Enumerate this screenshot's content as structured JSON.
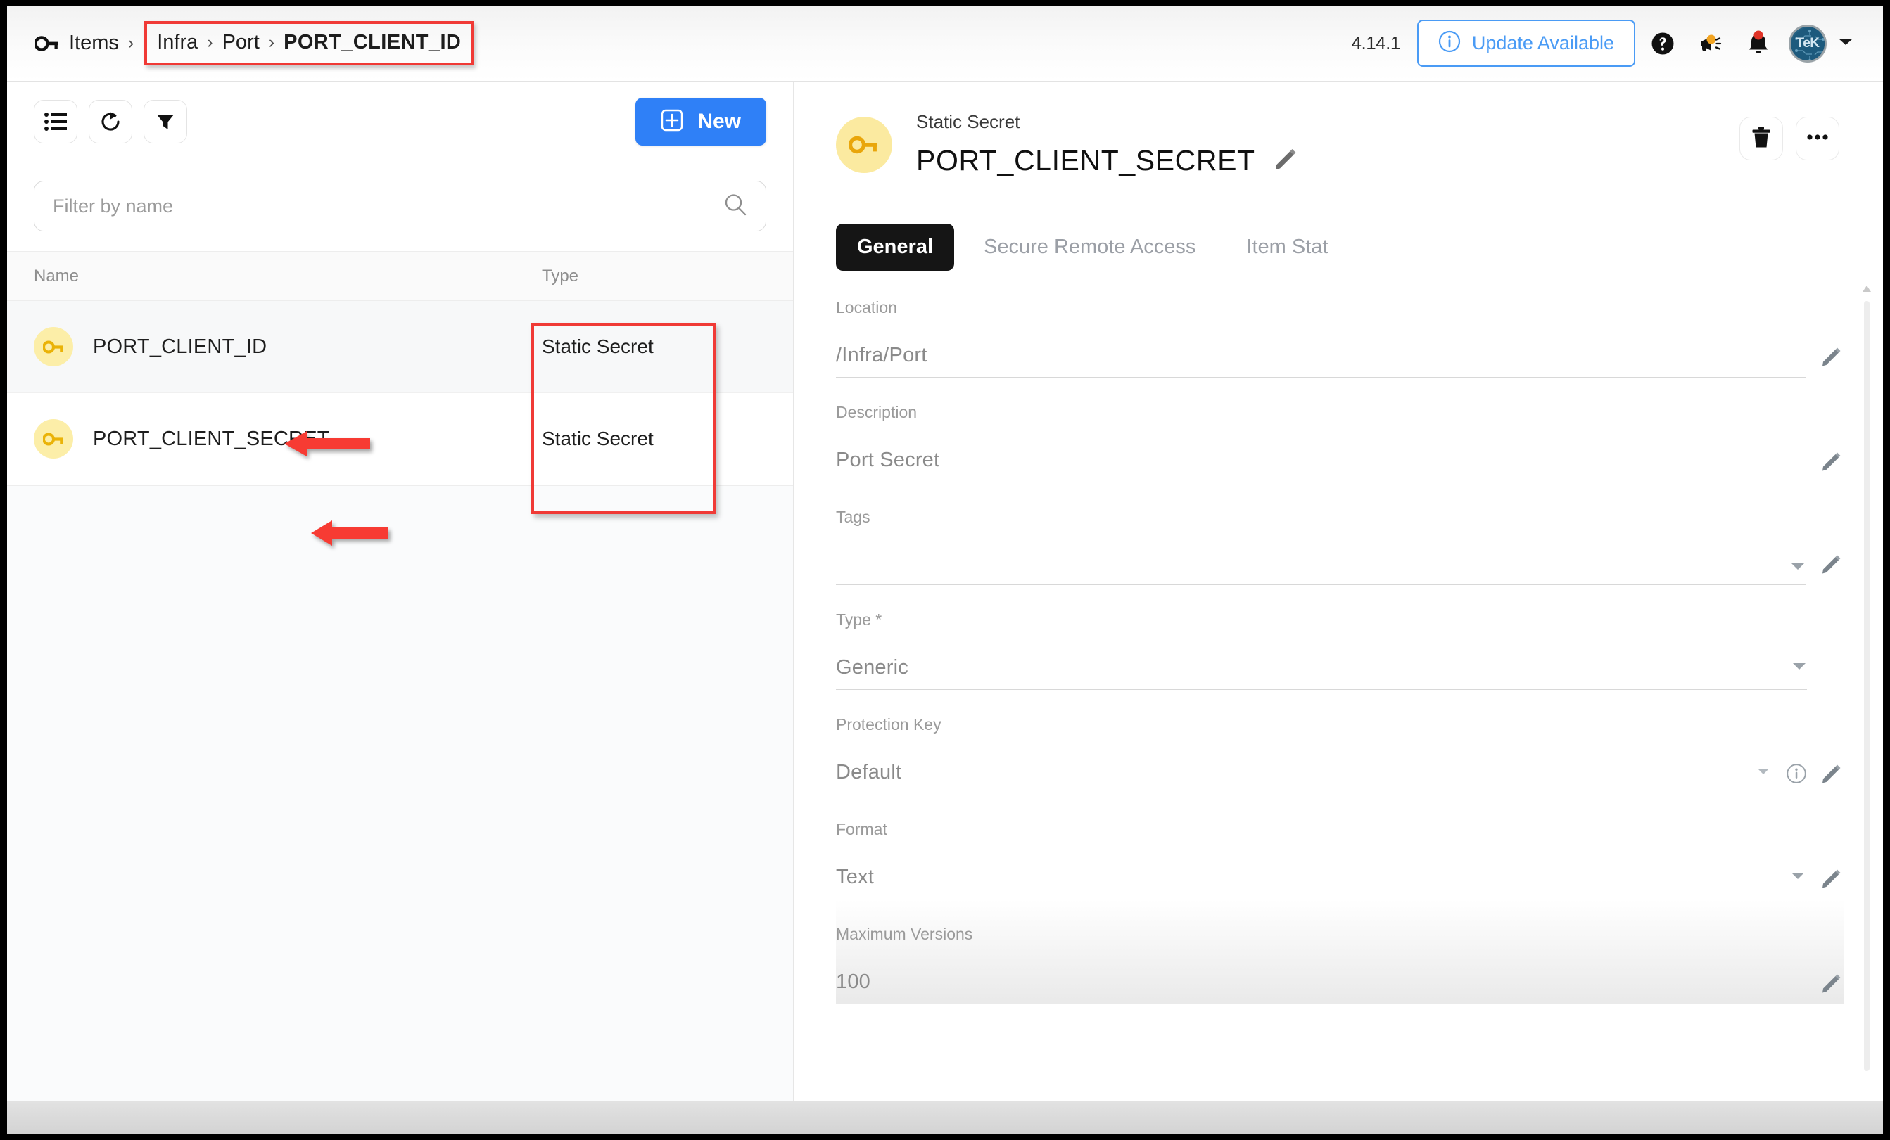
{
  "topbar": {
    "root_crumb": "Items",
    "separator": "›",
    "breadcrumb_highlighted": [
      {
        "label": "Infra",
        "bold": false
      },
      {
        "label": "Port",
        "bold": false
      },
      {
        "label": "PORT_CLIENT_ID",
        "bold": true
      }
    ],
    "version": "4.14.1",
    "update_label": "Update Available",
    "avatar_initials": "TeK",
    "icons": {
      "key": "key-icon",
      "info": "info-circle-icon",
      "help": "help-circle-icon",
      "announcement": "megaphone-icon",
      "notification": "bell-icon",
      "caret": "chevron-down-icon"
    }
  },
  "left_panel": {
    "toolbar": {
      "list_view": "list-view-icon",
      "refresh": "refresh-icon",
      "filter": "funnel-filter-icon",
      "new_label": "New",
      "new_icon": "plus-square-icon"
    },
    "filter": {
      "placeholder": "Filter by name",
      "value": "",
      "search_icon": "search-icon"
    },
    "columns": [
      "Name",
      "Type"
    ],
    "rows": [
      {
        "name": "PORT_CLIENT_ID",
        "type": "Static Secret",
        "icon": "key-icon",
        "selected": true
      },
      {
        "name": "PORT_CLIENT_SECRET",
        "type": "Static Secret",
        "icon": "key-icon",
        "selected": false
      }
    ]
  },
  "detail": {
    "subtitle": "Static Secret",
    "title": "PORT_CLIENT_SECRET",
    "edit_icon": "pencil-icon",
    "delete_icon": "trash-icon",
    "more_icon": "ellipsis-icon",
    "tabs": [
      {
        "label": "General",
        "active": true
      },
      {
        "label": "Secure Remote Access",
        "active": false
      },
      {
        "label": "Item Stat",
        "active": false
      }
    ],
    "fields": [
      {
        "label": "Location",
        "value": "/Infra/Port",
        "has_caret": false,
        "has_info": false,
        "has_pencil": true,
        "shaded": false
      },
      {
        "label": "Description",
        "value": "Port Secret",
        "has_caret": false,
        "has_info": false,
        "has_pencil": true,
        "shaded": false
      },
      {
        "label": "Tags",
        "value": "",
        "has_caret": true,
        "has_info": false,
        "has_pencil": true,
        "shaded": false
      },
      {
        "label": "Type *",
        "value": "Generic",
        "has_caret": true,
        "has_info": false,
        "has_pencil": false,
        "shaded": false
      },
      {
        "label": "Protection Key",
        "value": "Default",
        "has_caret": true,
        "has_info": true,
        "has_pencil": true,
        "shaded": false
      },
      {
        "label": "Format",
        "value": "Text",
        "has_caret": true,
        "has_info": false,
        "has_pencil": true,
        "shaded": false
      },
      {
        "label": "Maximum Versions",
        "value": "100",
        "has_caret": false,
        "has_info": false,
        "has_pencil": true,
        "shaded": true
      }
    ]
  },
  "annotations": {
    "accent_color": "#f03a36",
    "arrow_count": 2,
    "rect_count": 2
  }
}
